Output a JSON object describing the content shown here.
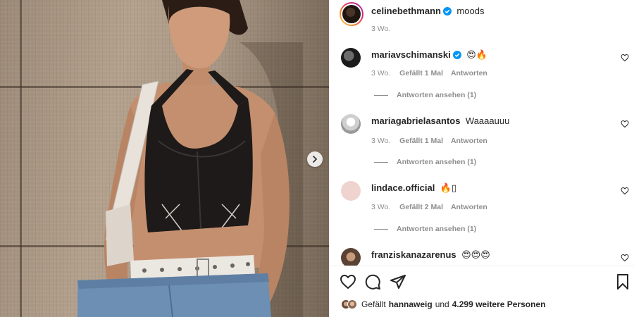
{
  "post": {
    "author": "celinebethmann",
    "caption": "moods",
    "time": "3 Wo."
  },
  "comments": [
    {
      "user": "mariavschimanski",
      "verified": true,
      "text": "😍🔥",
      "time": "3 Wo.",
      "likes": "Gefällt 1 Mal",
      "reply": "Antworten",
      "view_replies": "Antworten ansehen (1)"
    },
    {
      "user": "mariagabrielasantos",
      "verified": false,
      "text": "Waaaauuu",
      "time": "3 Wo.",
      "likes": "Gefällt 1 Mal",
      "reply": "Antworten",
      "view_replies": "Antworten ansehen (1)"
    },
    {
      "user": "lindace.official",
      "verified": false,
      "text": "🔥▯",
      "time": "3 Wo.",
      "likes": "Gefällt 2 Mal",
      "reply": "Antworten",
      "view_replies": "Antworten ansehen (1)"
    },
    {
      "user": "franziskanazarenus",
      "verified": false,
      "text": "😍😍😍"
    }
  ],
  "likes_summary": {
    "prefix": "Gefällt",
    "user": "hannaweig",
    "middle": "und",
    "count": "4.299 weitere Personen"
  },
  "icons": {
    "like": "heart-icon",
    "comment": "comment-icon",
    "share": "send-icon",
    "save": "bookmark-icon",
    "next": "chevron-right-icon",
    "verified": "verified-badge-icon"
  },
  "colors": {
    "verified": "#0095f6",
    "text": "#262626",
    "secondary": "#8e8e8e"
  }
}
